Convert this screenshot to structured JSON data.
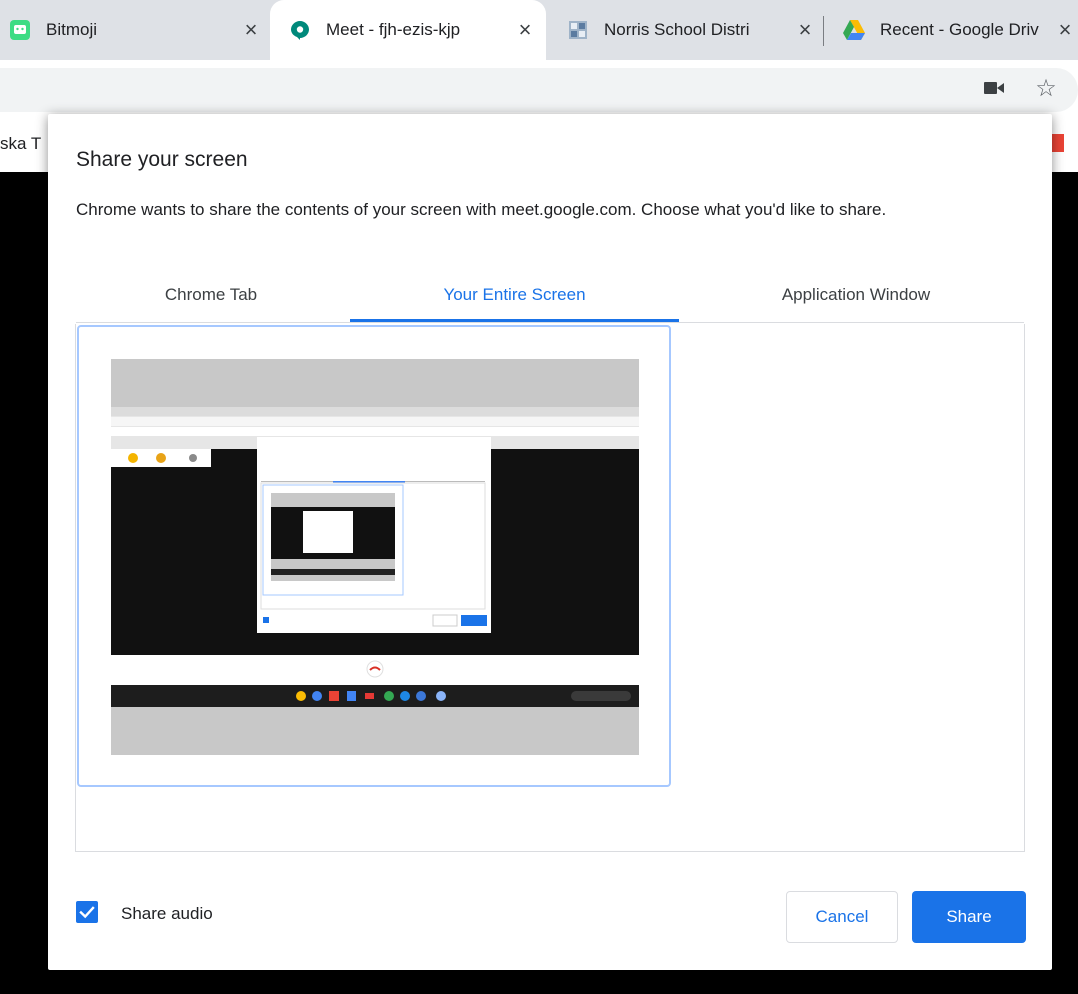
{
  "browser": {
    "tabs": [
      {
        "title": "Bitmoji",
        "icon": "bitmoji-icon",
        "close": "×"
      },
      {
        "title": "Meet - fjh-ezis-kjp",
        "icon": "google-meet-icon",
        "close": "×"
      },
      {
        "title": "Norris School Distri",
        "icon": "norris-school-icon",
        "close": "×"
      },
      {
        "title": "Recent - Google Driv",
        "icon": "google-drive-icon",
        "close": "×"
      }
    ],
    "bookmark_fragment": "ska T",
    "star_glyph": "☆"
  },
  "dialog": {
    "title": "Share your screen",
    "description": "Chrome wants to share the contents of your screen with meet.google.com. Choose what you'd like to share.",
    "tabs": [
      "Chrome Tab",
      "Your Entire Screen",
      "Application Window"
    ],
    "selected_tab": "Your Entire Screen",
    "share_audio_label": "Share audio",
    "share_audio_checked": true,
    "cancel_label": "Cancel",
    "share_label": "Share"
  },
  "colors": {
    "accent": "#1a73e8",
    "tile_border": "#a6c8ff",
    "tabstrip": "#dee1e6",
    "backdrop": "#000000"
  }
}
